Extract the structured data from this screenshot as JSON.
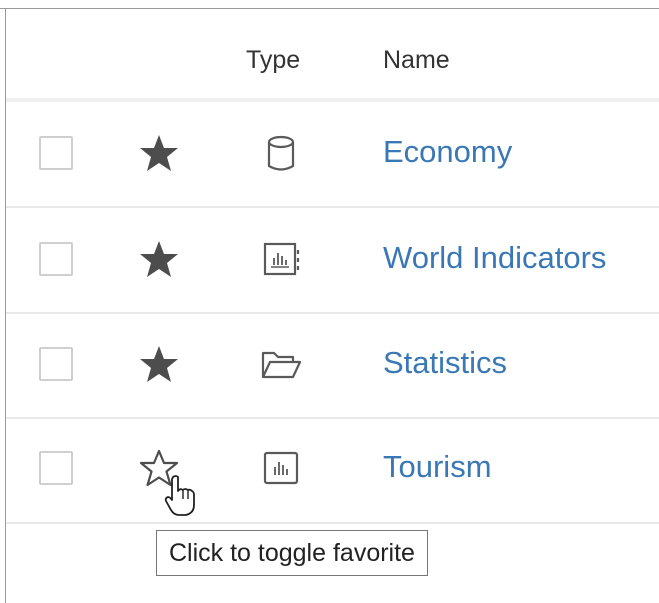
{
  "table": {
    "columns": {
      "type": "Type",
      "name": "Name"
    },
    "rows": [
      {
        "name": "Economy",
        "favorite": true,
        "type_icon": "database-icon",
        "checked": false
      },
      {
        "name": "World Indicators",
        "favorite": true,
        "type_icon": "workbook-icon",
        "checked": false
      },
      {
        "name": "Statistics",
        "favorite": true,
        "type_icon": "folder-icon",
        "checked": false
      },
      {
        "name": "Tourism",
        "favorite": false,
        "type_icon": "view-icon",
        "checked": false
      }
    ]
  },
  "tooltip": {
    "text": "Click to toggle favorite"
  },
  "colors": {
    "link": "#3a78b5",
    "star": "#4d4d4d",
    "icon": "#5a5a5a",
    "border": "#e9e9e9"
  }
}
